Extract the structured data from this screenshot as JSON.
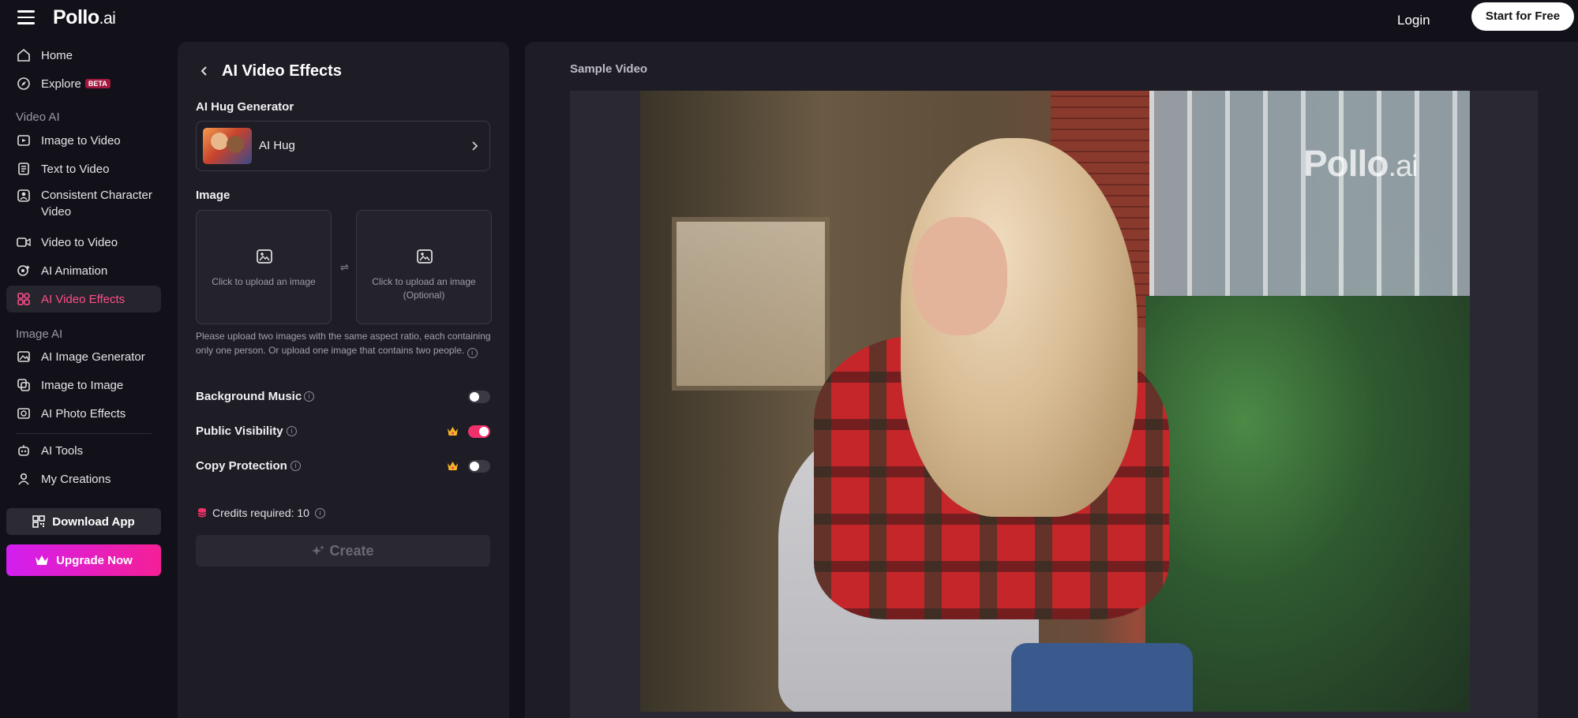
{
  "header": {
    "logo_main": "Pollo",
    "logo_suffix": ".ai",
    "login": "Login",
    "start_free": "Start for Free"
  },
  "sidebar": {
    "home": "Home",
    "explore": "Explore",
    "explore_badge": "BETA",
    "section_video": "Video AI",
    "image_to_video": "Image to Video",
    "text_to_video": "Text to Video",
    "consistent_character_line1": "Consistent Character",
    "consistent_character_line2": "Video",
    "video_to_video": "Video to Video",
    "ai_animation": "AI Animation",
    "ai_video_effects": "AI Video Effects",
    "section_image": "Image AI",
    "ai_image_generator": "AI Image Generator",
    "image_to_image": "Image to Image",
    "ai_photo_effects": "AI Photo Effects",
    "ai_tools": "AI Tools",
    "my_creations": "My Creations",
    "download_app": "Download App",
    "upgrade_now": "Upgrade Now",
    "active_item": "ai_video_effects"
  },
  "panel": {
    "title": "AI Video Effects",
    "generator_label": "AI Hug Generator",
    "effect_name": "AI Hug",
    "image_label": "Image",
    "upload_primary": "Click to upload an image",
    "upload_secondary_line1": "Click to upload an image",
    "upload_secondary_line2": "(Optional)",
    "help_text": "Please upload two images with the same aspect ratio, each containing only one person. Or upload one image that contains two people.",
    "background_music": "Background Music",
    "public_visibility": "Public Visibility",
    "copy_protection": "Copy Protection",
    "credits_label": "Credits required: 10",
    "create": "Create",
    "toggles": {
      "background_music": false,
      "public_visibility": true,
      "copy_protection": false
    }
  },
  "preview": {
    "label": "Sample Video",
    "watermark_main": "Pollo",
    "watermark_suffix": ".ai"
  },
  "colors": {
    "accent": "#ff4d8d",
    "toggle_on": "#f0306a",
    "upgrade_gradient_start": "#d21ef0",
    "upgrade_gradient_end": "#f51f96",
    "background": "#121119",
    "panel": "#1e1d26"
  },
  "icons": {
    "menu": "hamburger-icon",
    "home": "home-icon",
    "explore": "compass-icon",
    "video": "film-icon",
    "text": "document-icon",
    "character": "person-frame-icon",
    "video_to_video": "video-camera-icon",
    "animation": "sparkle-person-icon",
    "effects": "effects-grid-icon",
    "image_generator": "image-sparkle-icon",
    "image_to_image": "image-swap-icon",
    "photo_effects": "photo-effects-icon",
    "tools": "robot-icon",
    "creations": "user-icon",
    "qr": "qr-code-icon",
    "crown": "crown-icon"
  }
}
